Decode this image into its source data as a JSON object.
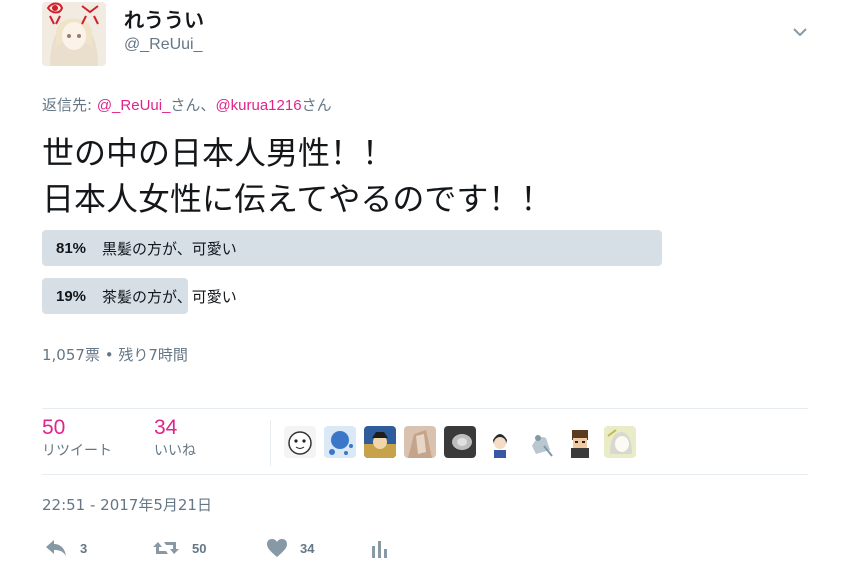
{
  "user": {
    "display_name": "れううい",
    "handle": "@_ReUui_"
  },
  "reply": {
    "prefix": "返信先: ",
    "mention1": "@_ReUui_",
    "sep1": "さん、",
    "mention2": "@kurua1216",
    "sep2": "さん"
  },
  "tweet": {
    "line1": "世の中の日本人男性！！",
    "line2": "日本人女性に伝えてやるのです！！"
  },
  "poll": {
    "options": [
      {
        "percent": "81%",
        "label": "黒髪の方が、可愛い",
        "value": 81
      },
      {
        "percent": "19%",
        "label": "茶髪の方が、可愛い",
        "value": 19
      }
    ],
    "meta": "1,057票 • 残り7時間"
  },
  "stats": {
    "retweets_count": "50",
    "retweets_label": "リツイート",
    "likes_count": "34",
    "likes_label": "いいね"
  },
  "timestamp": "22:51 - 2017年5月21日",
  "actions": {
    "reply_count": "3",
    "retweet_count": "50",
    "like_count": "34"
  },
  "colors": {
    "accent": "#e0248a",
    "muted": "#657786",
    "poll_bar": "#d6dfe6"
  }
}
